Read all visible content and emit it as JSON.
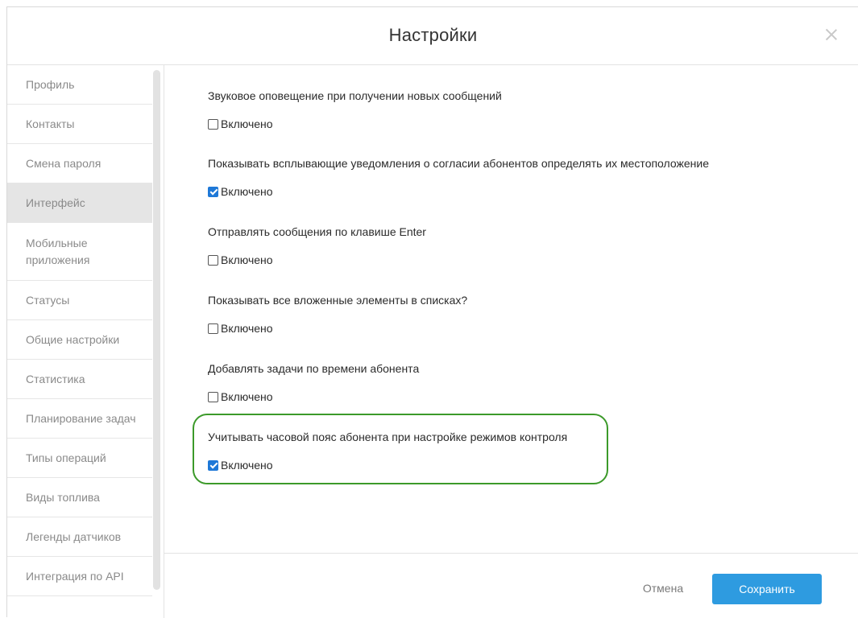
{
  "dialog": {
    "title": "Настройки"
  },
  "sidebar": {
    "items": [
      {
        "label": "Профиль"
      },
      {
        "label": "Контакты"
      },
      {
        "label": "Смена пароля"
      },
      {
        "label": "Интерфейс",
        "active": true
      },
      {
        "label": "Мобильные приложения"
      },
      {
        "label": "Статусы"
      },
      {
        "label": "Общие настройки"
      },
      {
        "label": "Статистика"
      },
      {
        "label": "Планирование задач"
      },
      {
        "label": "Типы операций"
      },
      {
        "label": "Виды топлива"
      },
      {
        "label": "Легенды датчиков"
      },
      {
        "label": "Интеграция по API"
      }
    ]
  },
  "settings": [
    {
      "label": "Звуковое оповещение при получении новых сообщений",
      "checkbox_label": "Включено",
      "checked": false
    },
    {
      "label": "Показывать всплывающие уведомления о согласии абонентов определять их местоположение",
      "checkbox_label": "Включено",
      "checked": true
    },
    {
      "label": "Отправлять сообщения по клавише Enter",
      "checkbox_label": "Включено",
      "checked": false
    },
    {
      "label": "Показывать все вложенные элементы в списках?",
      "checkbox_label": "Включено",
      "checked": false
    },
    {
      "label": "Добавлять задачи по времени абонента",
      "checkbox_label": "Включено",
      "checked": false
    },
    {
      "label": "Учитывать часовой пояс абонента при настройке режимов контроля",
      "checkbox_label": "Включено",
      "checked": true,
      "highlighted": true
    }
  ],
  "footer": {
    "cancel_label": "Отмена",
    "save_label": "Сохранить"
  },
  "colors": {
    "accent": "#2e9be0",
    "checkbox_checked": "#1e78d7",
    "highlight_border": "#3c9a2a"
  }
}
